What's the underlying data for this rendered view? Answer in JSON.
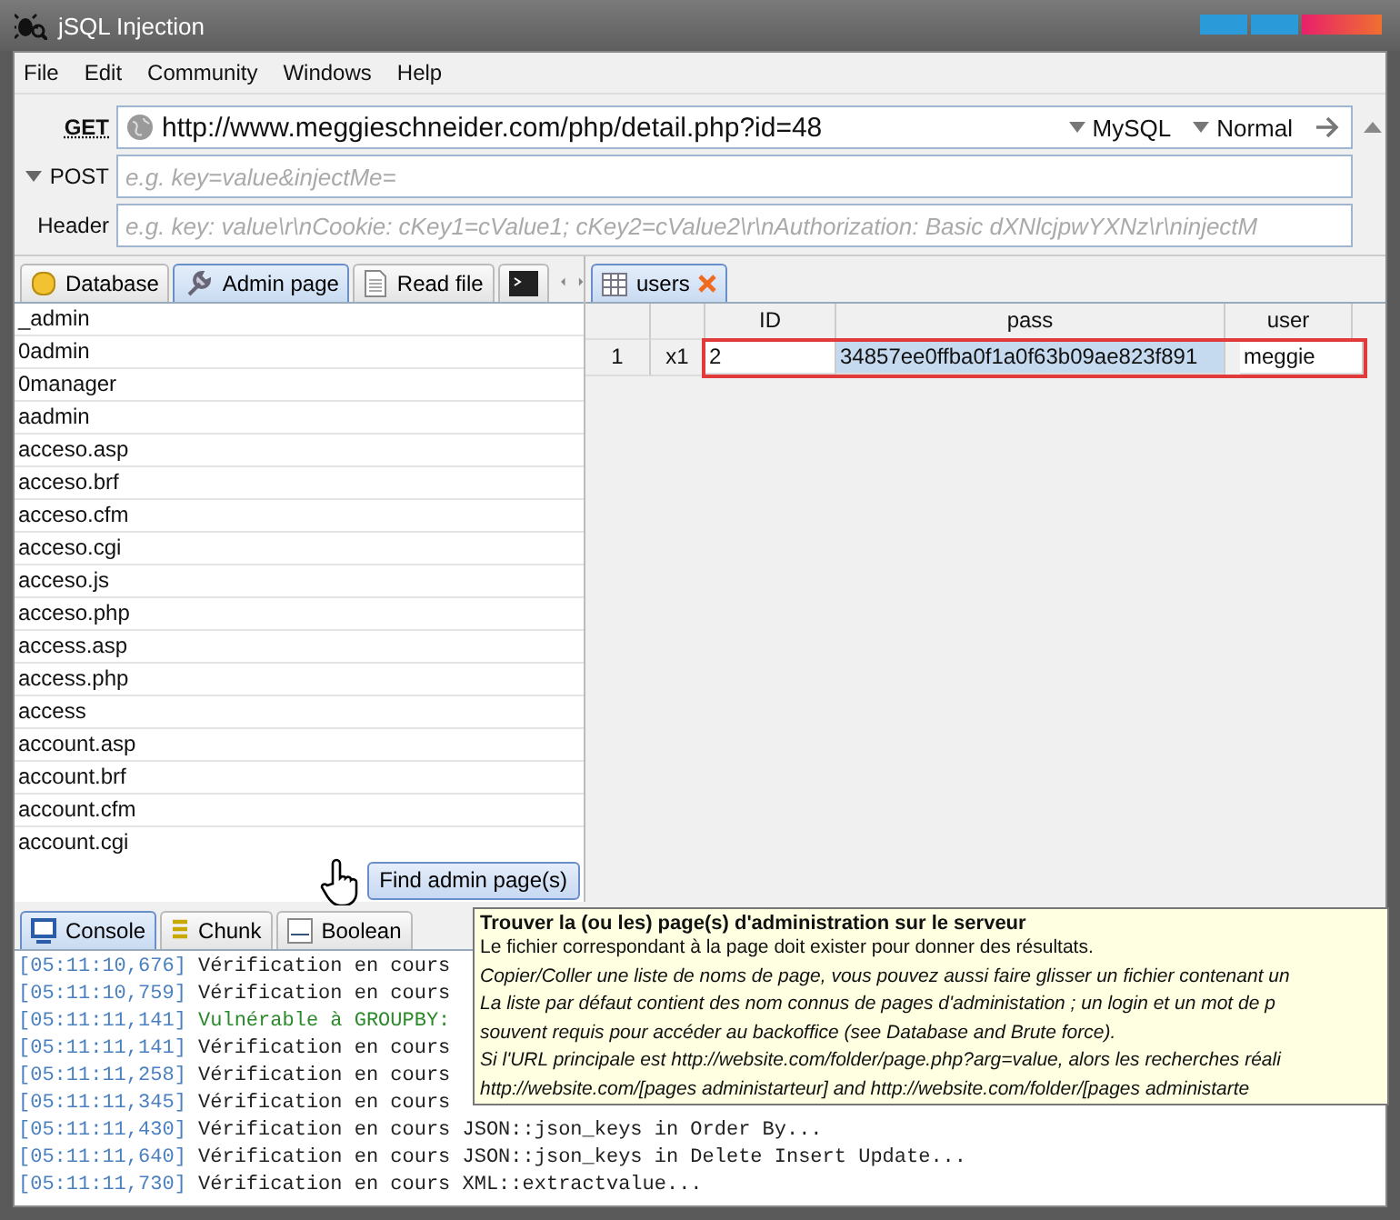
{
  "window": {
    "title": "jSQL Injection"
  },
  "menu": [
    {
      "label": "File"
    },
    {
      "label": "Edit"
    },
    {
      "label": "Community"
    },
    {
      "label": "Windows"
    },
    {
      "label": "Help"
    }
  ],
  "request": {
    "get_label": "GET",
    "url": "http://www.meggieschneider.com/php/detail.php?id=48",
    "database": "MySQL",
    "strategy": "Normal",
    "post_label": "POST",
    "post_placeholder": "e.g. key=value&injectMe=",
    "header_label": "Header",
    "header_placeholder": "e.g. key: value\\r\\nCookie: cKey1=cValue1; cKey2=cValue2\\r\\nAuthorization: Basic dXNlcjpwYXNz\\r\\ninjectM"
  },
  "left_tabs": [
    {
      "kind": "database",
      "label": "Database",
      "selected": false
    },
    {
      "kind": "admin",
      "label": "Admin page",
      "selected": true
    },
    {
      "kind": "file",
      "label": "Read file",
      "selected": false
    },
    {
      "kind": "terminal",
      "selected": false
    }
  ],
  "admin_pages": [
    "_admin",
    "0admin",
    "0manager",
    "aadmin",
    "acceso.asp",
    "acceso.brf",
    "acceso.cfm",
    "acceso.cgi",
    "acceso.js",
    "acceso.php",
    "access.asp",
    "access.php",
    "access",
    "account.asp",
    "account.brf",
    "account.cfm",
    "account.cgi"
  ],
  "find_button": "Find admin page(s)",
  "result_tabs": [
    {
      "label": "users",
      "selected": true
    }
  ],
  "table": {
    "columns": [
      "ID",
      "pass",
      "user"
    ],
    "rows": [
      {
        "number": "1",
        "marker": "x1",
        "highlighted": true,
        "cells": [
          {
            "text": "2",
            "selected": false
          },
          {
            "text": "34857ee0ffba0f1a0f63b09ae823f891",
            "selected": true
          },
          {
            "text": "meggie",
            "selected": false
          }
        ]
      }
    ]
  },
  "console_tabs": [
    {
      "kind": "console",
      "label": "Console",
      "selected": true
    },
    {
      "kind": "chunk",
      "label": "Chunk",
      "selected": false
    },
    {
      "kind": "boolean",
      "label": "Boolean",
      "selected": false
    }
  ],
  "console_lines": [
    {
      "time": "[05:11:10,676]",
      "text": "Vérification en cours",
      "kind": "info"
    },
    {
      "time": "[05:11:10,759]",
      "text": "Vérification en cours",
      "kind": "info"
    },
    {
      "time": "[05:11:11,141]",
      "text": "Vulnérable à GROUPBY:",
      "kind": "success"
    },
    {
      "time": "[05:11:11,141]",
      "text": "Vérification en cours",
      "kind": "info"
    },
    {
      "time": "[05:11:11,258]",
      "text": "Vérification en cours",
      "kind": "info"
    },
    {
      "time": "[05:11:11,345]",
      "text": "Vérification en cours",
      "kind": "info"
    },
    {
      "time": "[05:11:11,430]",
      "text": "Vérification en cours JSON::json_keys in Order By...",
      "kind": "info"
    },
    {
      "time": "[05:11:11,640]",
      "text": "Vérification en cours JSON::json_keys in Delete Insert Update...",
      "kind": "info"
    },
    {
      "time": "[05:11:11,730]",
      "text": "Vérification en cours XML::extractvalue...",
      "kind": "info"
    }
  ],
  "tooltip": {
    "title": "Trouver la (ou les) page(s) d'administration sur le serveur",
    "lines": [
      {
        "text": "Le fichier correspondant à la page doit exister pour donner des résultats.",
        "italic": false
      },
      {
        "text": "Copier/Coller une liste de noms de page, vous pouvez aussi faire glisser un fichier contenant un",
        "italic": true
      },
      {
        "text": "La liste par défaut contient des nom connus de pages d'administation ; un login et un mot de p",
        "italic": true
      },
      {
        "text": "souvent requis pour accéder au backoffice (see Database and Brute force).",
        "italic": true
      },
      {
        "text": "Si l'URL principale est http://website.com/folder/page.php?arg=value, alors les recherches réali",
        "italic": true
      },
      {
        "text": "http://website.com/[pages administarteur] and http://website.com/folder/[pages administarte",
        "italic": true
      }
    ]
  }
}
